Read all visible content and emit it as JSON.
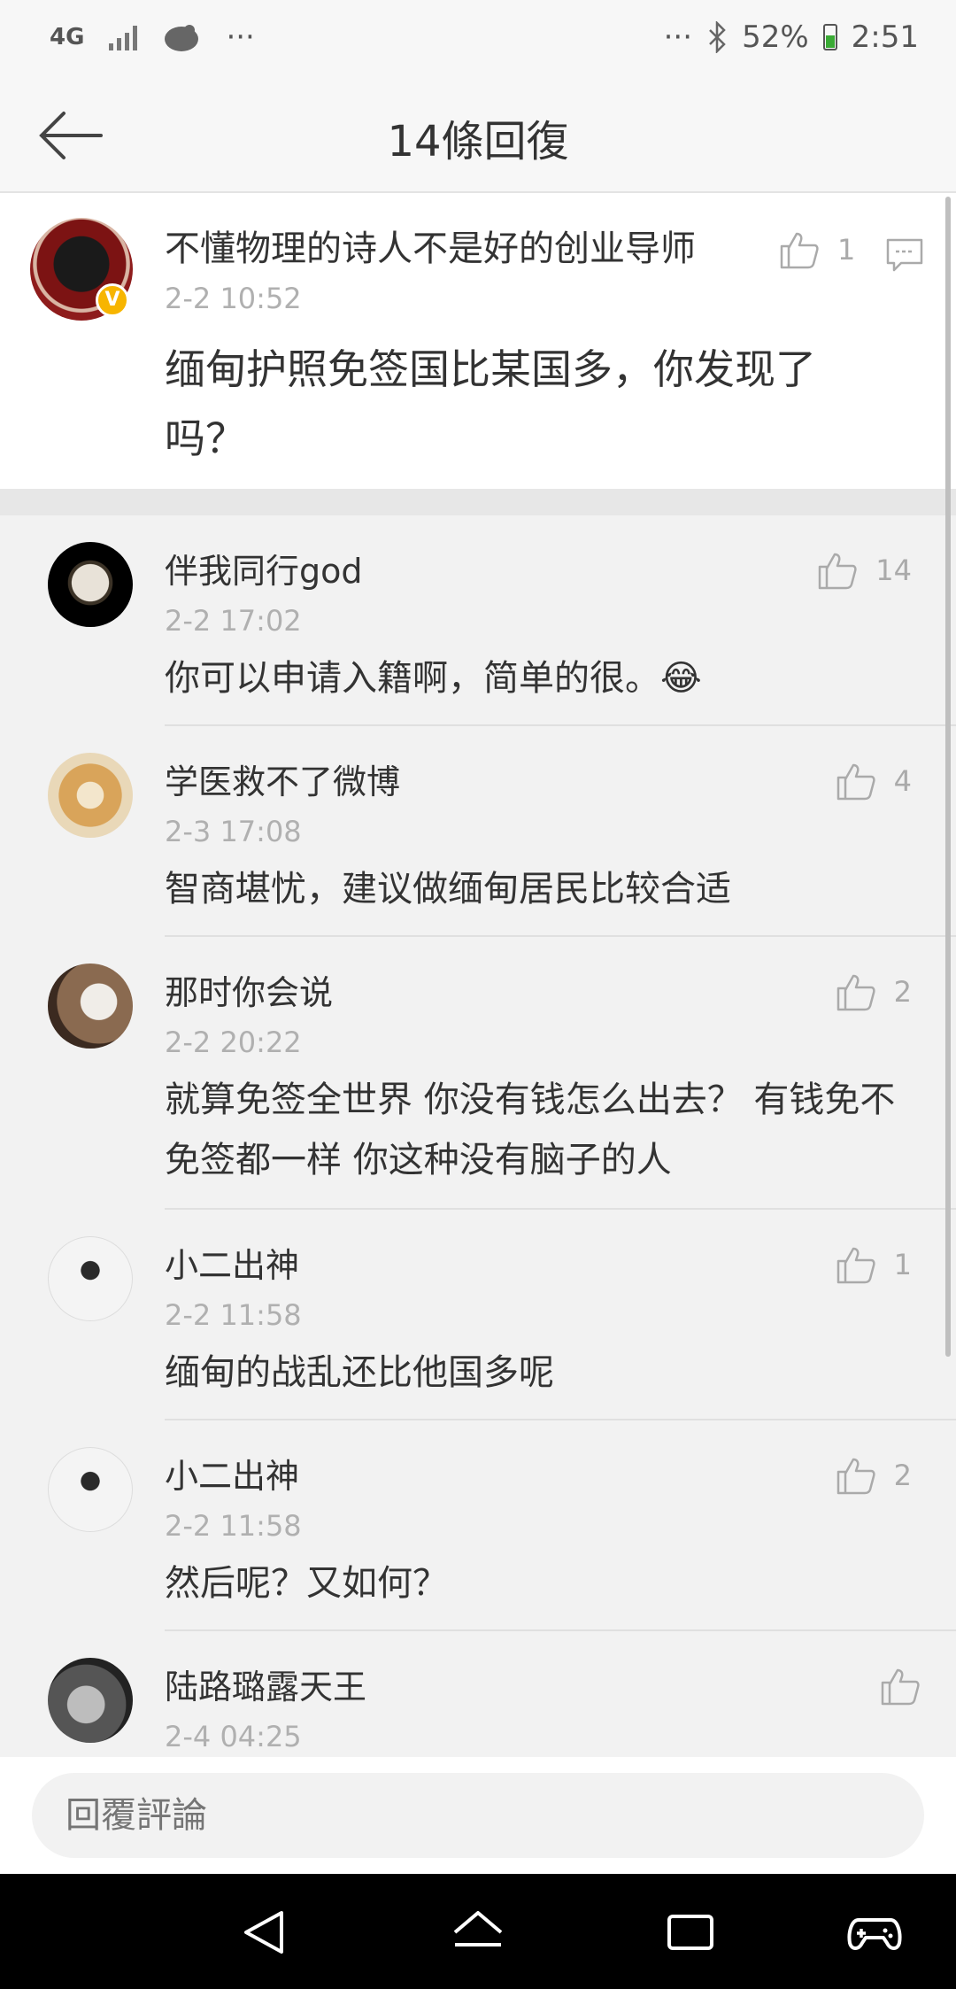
{
  "status": {
    "net": "4G",
    "dots": "···",
    "right_dots": "···",
    "battery": "52%",
    "time": "2:51"
  },
  "header": {
    "title": "14條回復",
    "back_icon": "back-arrow-icon"
  },
  "main_post": {
    "user": "不懂物理的诗人不是好的创业导师",
    "verified_mark": "V",
    "time": "2-2 10:52",
    "text": "缅甸护照免签国比某国多，你发现了吗？",
    "likes": "1"
  },
  "replies": [
    {
      "user": "伴我同行god",
      "time": "2-2 17:02",
      "text": "你可以申请入籍啊，简单的很。😂",
      "likes": "14",
      "avatar_color": "#000000"
    },
    {
      "user": "学医救不了微博",
      "time": "2-3 17:08",
      "text": "智商堪忧，建议做缅甸居民比较合适",
      "likes": "4",
      "avatar_color": "#d9a45a"
    },
    {
      "user": "那时你会说",
      "time": "2-2 20:22",
      "text": "就算免签全世界 你没有钱怎么出去？ 有钱免不免签都一样 你这种没有脑子的人",
      "likes": "2",
      "avatar_color": "#8a6a50"
    },
    {
      "user": "小二出神",
      "time": "2-2 11:58",
      "text": "缅甸的战乱还比他国多呢",
      "likes": "1",
      "avatar_color": "#efefef"
    },
    {
      "user": "小二出神",
      "time": "2-2 11:58",
      "text": "然后呢？又如何？",
      "likes": "2",
      "avatar_color": "#efefef"
    },
    {
      "user": "陆路璐露天王",
      "time": "2-4 04:25",
      "text": "",
      "likes": "",
      "avatar_color": "#555555"
    }
  ],
  "footer": {
    "reply_placeholder": "回覆評論"
  },
  "colors": {
    "accent_verified": "#f7b500",
    "secondary_text": "#b0b0b0"
  }
}
